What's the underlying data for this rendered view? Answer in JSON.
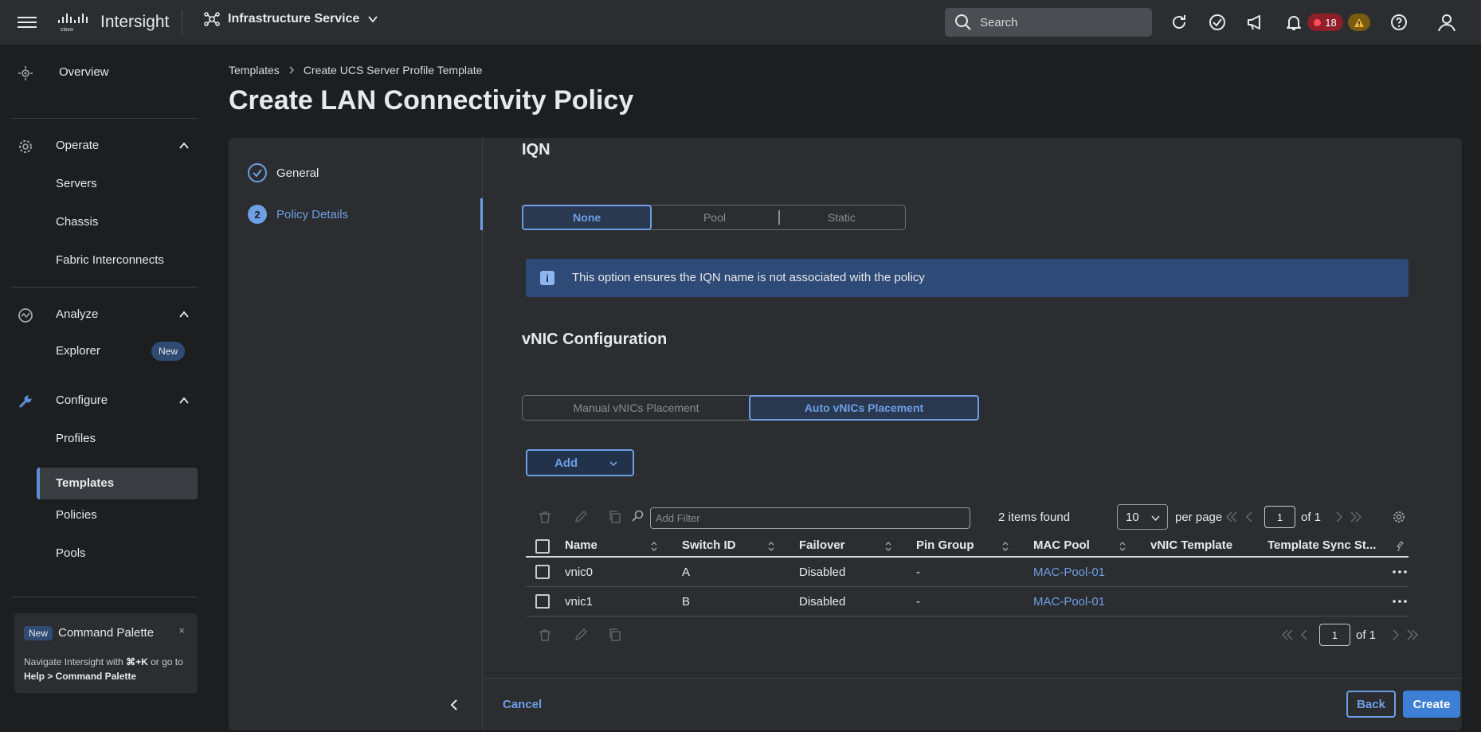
{
  "topbar": {
    "app_name": "Intersight",
    "service": "Infrastructure Service",
    "search_placeholder": "Search",
    "alarms_critical_count": "18"
  },
  "sidebar": {
    "overview": "Overview",
    "operate": {
      "label": "Operate",
      "items": [
        "Servers",
        "Chassis",
        "Fabric Interconnects"
      ]
    },
    "analyze": {
      "label": "Analyze",
      "items": [
        "Explorer"
      ],
      "new_badge": "New"
    },
    "configure": {
      "label": "Configure",
      "items": [
        "Profiles",
        "Templates",
        "Policies",
        "Pools"
      ],
      "active": "Templates"
    },
    "command_palette": {
      "badge": "New",
      "title": "Command Palette",
      "close": "×",
      "desc_prefix": "Navigate Intersight with",
      "shortcut": "⌘+K",
      "desc_mid": "or go to",
      "desc_path": "Help > Command Palette"
    }
  },
  "breadcrumb": [
    "Templates",
    "Create UCS Server Profile Template"
  ],
  "page_title": "Create LAN Connectivity Policy",
  "steps": [
    {
      "num": "",
      "label": "General",
      "state": "done"
    },
    {
      "num": "2",
      "label": "Policy Details",
      "state": "current"
    }
  ],
  "iqn": {
    "title": "IQN",
    "options": [
      "None",
      "Pool",
      "Static"
    ],
    "selected": "None",
    "info_icon": "i",
    "info": "This option ensures the IQN name is not associated with the policy"
  },
  "vnic": {
    "title": "vNIC Configuration",
    "placement_options": [
      "Manual vNICs Placement",
      "Auto vNICs Placement"
    ],
    "selected": "Auto vNICs Placement",
    "add_label": "Add"
  },
  "table": {
    "filter_placeholder": "Add Filter",
    "items_found": "2 items found",
    "per_page_value": "10",
    "per_page_label": "per page",
    "page": "1",
    "of_pages": "of 1",
    "columns": [
      "Name",
      "Switch ID",
      "Failover",
      "Pin Group",
      "MAC Pool",
      "vNIC Template",
      "Template Sync St..."
    ],
    "rows": [
      {
        "name": "vnic0",
        "switch_id": "A",
        "failover": "Disabled",
        "pin_group": "-",
        "mac_pool": "MAC-Pool-01",
        "vnic_template": "",
        "sync": ""
      },
      {
        "name": "vnic1",
        "switch_id": "B",
        "failover": "Disabled",
        "pin_group": "-",
        "mac_pool": "MAC-Pool-01",
        "vnic_template": "",
        "sync": ""
      }
    ]
  },
  "footer": {
    "cancel": "Cancel",
    "back": "Back",
    "create": "Create"
  },
  "colors": {
    "accent": "#6e9fe5",
    "info_bg": "#2e4a77",
    "critical": "#8e1f28",
    "warning": "#7a5b12"
  }
}
